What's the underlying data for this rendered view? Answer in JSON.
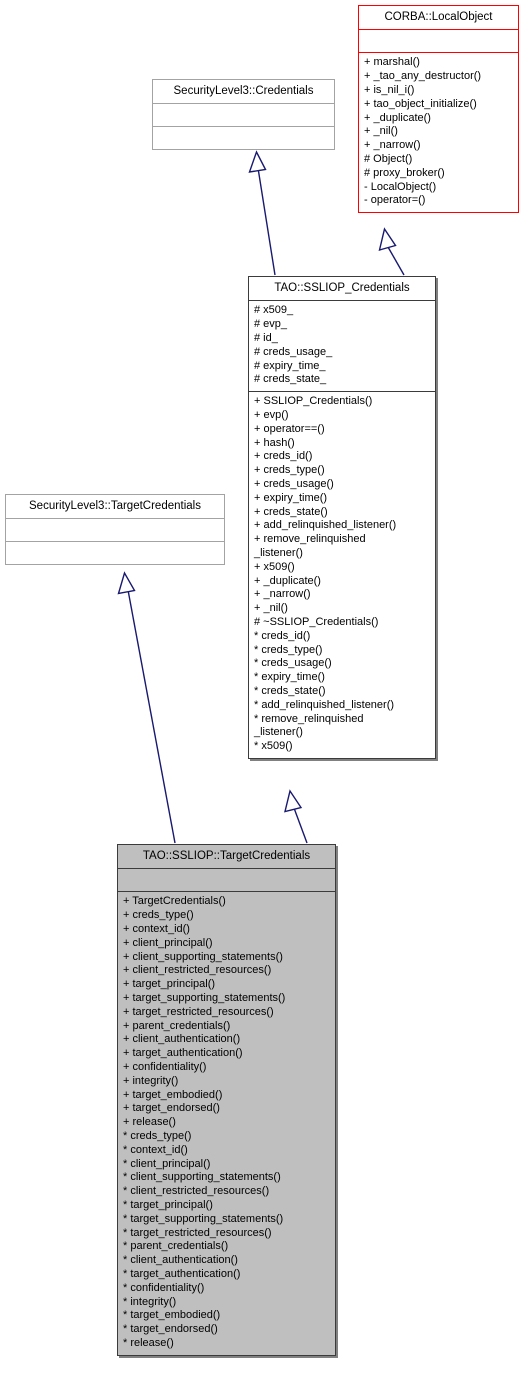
{
  "diagram": {
    "kind": "uml-class-inheritance-diagram",
    "background": "#ffffff",
    "edge_color": "#191970",
    "nodes": [
      {
        "id": "corba_localobject",
        "name": "CORBA::LocalObject",
        "style": "red",
        "border_color": "#ff0000",
        "attributes": [],
        "operations": [
          "+ marshal()",
          "+ _tao_any_destructor()",
          "+ is_nil_i()",
          "+ tao_object_initialize()",
          "+ _duplicate()",
          "+ _nil()",
          "+ _narrow()",
          "# Object()",
          "# proxy_broker()",
          "- LocalObject()",
          "- operator=()"
        ]
      },
      {
        "id": "securitylevel3_credentials",
        "name": "SecurityLevel3::Credentials",
        "style": "plain",
        "border_color": "#a3a3a3",
        "attributes": [],
        "operations": []
      },
      {
        "id": "tao_ssliop_credentials",
        "name": "TAO::SSLIOP_Credentials",
        "style": "solid",
        "border_color": "#3b3b3b",
        "attributes": [
          "# x509_",
          "# evp_",
          "# id_",
          "# creds_usage_",
          "# expiry_time_",
          "# creds_state_"
        ],
        "operations": [
          "+ SSLIOP_Credentials()",
          "+ evp()",
          "+ operator==()",
          "+ hash()",
          "+ creds_id()",
          "+ creds_type()",
          "+ creds_usage()",
          "+ expiry_time()",
          "+ creds_state()",
          "+ add_relinquished_listener()",
          "+ remove_relinquished",
          "_listener()",
          "+ x509()",
          "+ _duplicate()",
          "+ _narrow()",
          "+ _nil()",
          "# ~SSLIOP_Credentials()",
          "* creds_id()",
          "* creds_type()",
          "* creds_usage()",
          "* expiry_time()",
          "* creds_state()",
          "* add_relinquished_listener()",
          "* remove_relinquished",
          "_listener()",
          "* x509()"
        ]
      },
      {
        "id": "securitylevel3_targetcredentials",
        "name": "SecurityLevel3::TargetCredentials",
        "style": "plain",
        "border_color": "#a3a3a3",
        "attributes": [],
        "operations": []
      },
      {
        "id": "tao_ssliop_targetcredentials",
        "name": "TAO::SSLIOP::TargetCredentials",
        "style": "filled",
        "border_color": "#3b3b3b",
        "fill_color": "#bfbfbf",
        "attributes": [],
        "operations": [
          "+ TargetCredentials()",
          "+ creds_type()",
          "+ context_id()",
          "+ client_principal()",
          "+ client_supporting_statements()",
          "+ client_restricted_resources()",
          "+ target_principal()",
          "+ target_supporting_statements()",
          "+ target_restricted_resources()",
          "+ parent_credentials()",
          "+ client_authentication()",
          "+ target_authentication()",
          "+ confidentiality()",
          "+ integrity()",
          "+ target_embodied()",
          "+ target_endorsed()",
          "+ release()",
          "* creds_type()",
          "* context_id()",
          "* client_principal()",
          "* client_supporting_statements()",
          "* client_restricted_resources()",
          "* target_principal()",
          "* target_supporting_statements()",
          "* target_restricted_resources()",
          "* parent_credentials()",
          "* client_authentication()",
          "* target_authentication()",
          "* confidentiality()",
          "* integrity()",
          "* target_embodied()",
          "* target_endorsed()",
          "* release()"
        ]
      }
    ],
    "edges": [
      {
        "from": "tao_ssliop_credentials",
        "to": "securitylevel3_credentials",
        "type": "generalization"
      },
      {
        "from": "tao_ssliop_credentials",
        "to": "corba_localobject",
        "type": "generalization"
      },
      {
        "from": "tao_ssliop_targetcredentials",
        "to": "securitylevel3_targetcredentials",
        "type": "generalization"
      },
      {
        "from": "tao_ssliop_targetcredentials",
        "to": "tao_ssliop_credentials",
        "type": "generalization"
      }
    ]
  }
}
